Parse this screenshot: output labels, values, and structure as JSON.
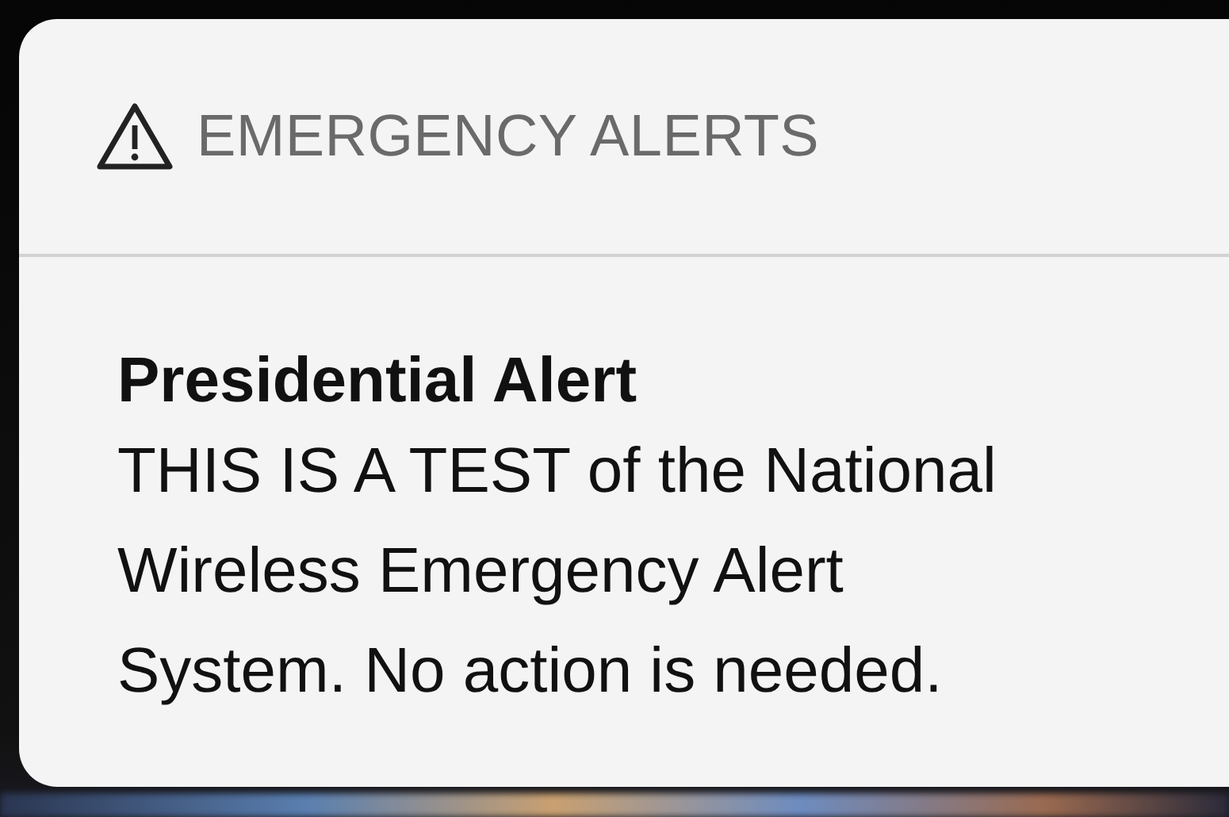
{
  "notification": {
    "app_name": "EMERGENCY ALERTS",
    "title": "Presidential Alert",
    "body_lines": [
      "THIS IS A TEST of the National",
      "Wireless Emergency Alert",
      "System. No action is needed."
    ]
  }
}
